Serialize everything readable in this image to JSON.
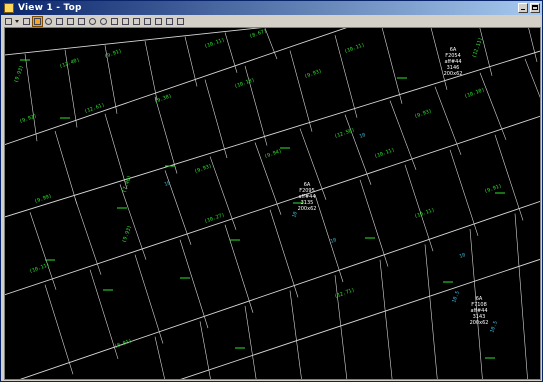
{
  "window": {
    "title": "View 1 - Top"
  },
  "toolbar": {
    "icons": [
      "view-options-icon",
      "dropdown-arrow-icon",
      "element-select-icon",
      "pan-icon",
      "zoom-in-icon",
      "zoom-out-icon",
      "window-area-icon",
      "fit-view-icon",
      "rotate-view-icon",
      "view-previous-icon",
      "view-next-icon",
      "copy-view-icon",
      "update-view-icon",
      "clip-volume-icon",
      "level-display-icon",
      "camera-icon",
      "view-attributes-icon"
    ],
    "selected_index": 3
  },
  "colors": {
    "background": "#000000",
    "parcel_line": "#d8d8d8",
    "lot_label": "#2ee52e",
    "lot_dash": "#2ee52e",
    "cyan_label": "#3fb6d9",
    "block_label": "#ffffff"
  },
  "blocks": [
    {
      "id": "block-1",
      "lines": [
        "6A",
        "F2054",
        "aff#44",
        "3146",
        "200x62"
      ]
    },
    {
      "id": "block-2",
      "lines": [
        "6A",
        "F2095",
        "aff#44",
        "3135",
        "200x62"
      ]
    },
    {
      "id": "block-3",
      "lines": [
        "6A",
        "F7108",
        "aff#44",
        "3143",
        "200x62"
      ]
    }
  ],
  "lot_labels": [
    "(9.93)",
    "(12.40)",
    "(9.91)",
    "(10.11)",
    "(8.67)",
    "(10.11)",
    "(12.11)",
    "(9.92)",
    "(12.61)",
    "(9.38)",
    "(10.18)",
    "(9.93)",
    "(10.11)",
    "(9.93)",
    "(10.10)",
    "(9.99)",
    "(7.40)",
    "(9.93)",
    "(9.94)",
    "(12.50)",
    "(10.11)",
    "(9.93)",
    "(10.27)",
    "(10.11)",
    "(9.91)",
    "(8.91)",
    "(12.71)"
  ],
  "cyan_labels": [
    "10",
    "10",
    "10",
    "10",
    "10",
    "10.5",
    "10.5"
  ]
}
